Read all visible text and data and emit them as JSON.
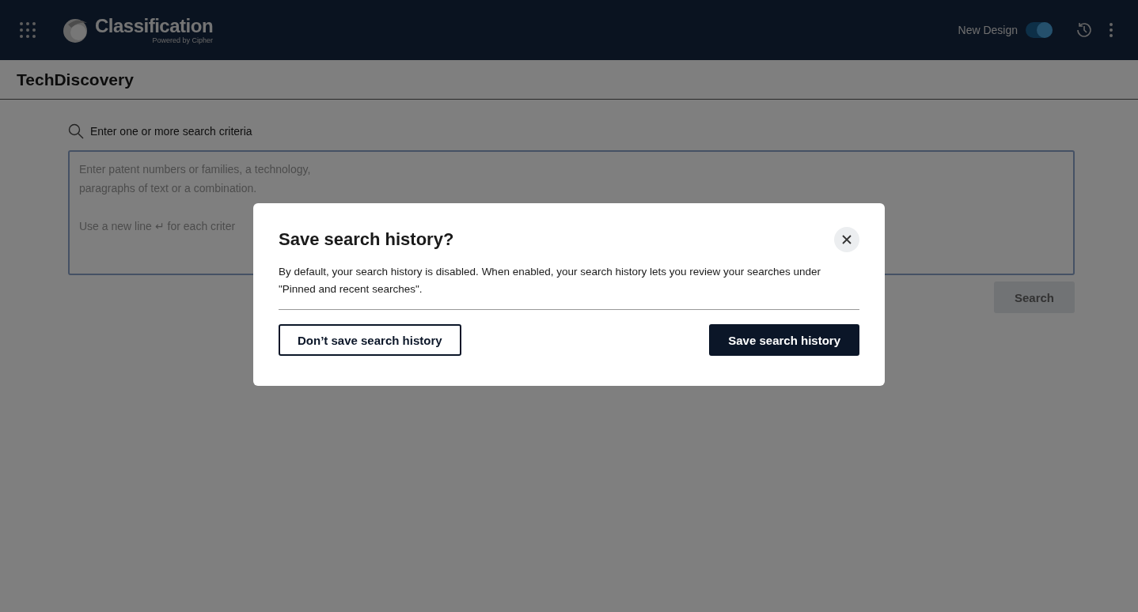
{
  "header": {
    "app_name": "Classification",
    "tagline": "Powered by Cipher",
    "toggle": {
      "label": "New Design",
      "on": true
    }
  },
  "page": {
    "title": "TechDiscovery"
  },
  "search": {
    "label": "Enter one or more search criteria",
    "placeholder_lines": [
      "Enter patent numbers or families, a technology,",
      "paragraphs of text or a combination."
    ],
    "hint": "Use a new line ↵ for each criter",
    "button": "Search"
  },
  "dialog": {
    "title": "Save search history?",
    "body": "By default, your search history is disabled. When enabled, your search history lets you review your searches under \"Pinned and recent searches\".",
    "buttons": [
      {
        "label": "Don’t save search history",
        "kind": "secondary"
      },
      {
        "label": "Save search history",
        "kind": "primary"
      }
    ]
  }
}
